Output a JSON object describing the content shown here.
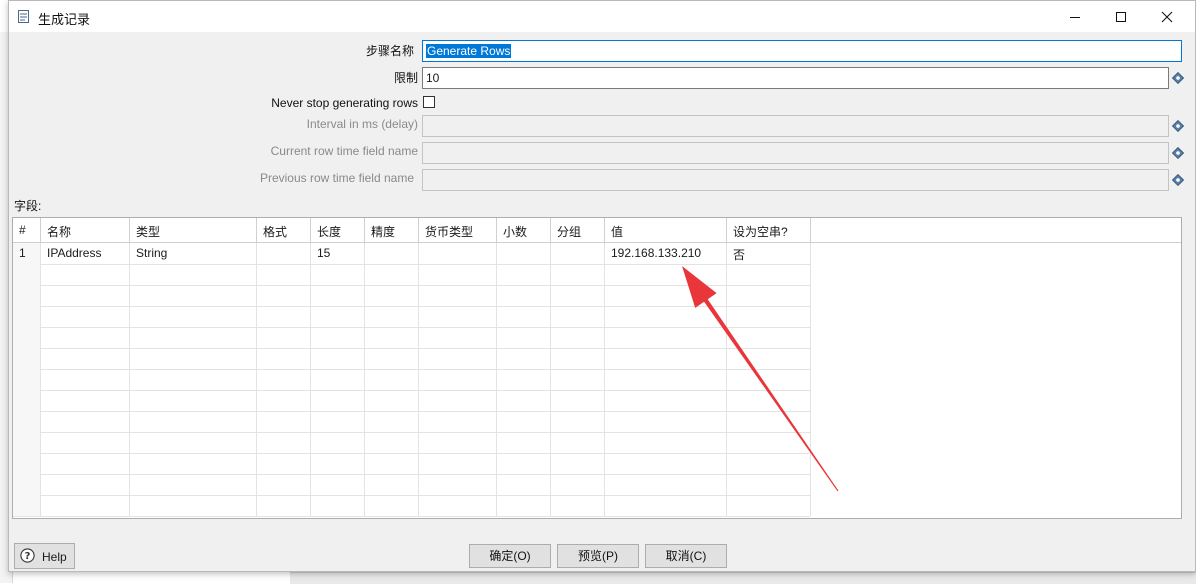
{
  "window": {
    "title": "生成记录"
  },
  "form": {
    "step_name_label": "步骤名称",
    "step_name_value": "Generate Rows",
    "limit_label": "限制",
    "limit_value": "10",
    "never_stop_label": "Never stop generating rows",
    "never_stop_checked": false,
    "interval_label": "Interval in ms (delay)",
    "interval_value": "",
    "current_row_time_label": "Current row time field name",
    "current_row_time_value": "",
    "previous_row_time_label": "Previous row time field name",
    "previous_row_time_value": ""
  },
  "fields_section": {
    "label": "字段:",
    "columns": [
      "#",
      "名称",
      "类型",
      "格式",
      "长度",
      "精度",
      "货币类型",
      "小数",
      "分组",
      "值",
      "设为空串?"
    ],
    "rows": [
      {
        "num": "1",
        "name": "IPAddress",
        "type": "String",
        "format": "",
        "length": "15",
        "precision": "",
        "currency": "",
        "decimal": "",
        "group": "",
        "value": "192.168.133.210",
        "set_empty": "否"
      }
    ]
  },
  "buttons": {
    "help": "Help",
    "ok": "确定(O)",
    "preview": "预览(P)",
    "cancel": "取消(C)"
  },
  "annotation": {
    "arrow_color": "#e8363a"
  }
}
